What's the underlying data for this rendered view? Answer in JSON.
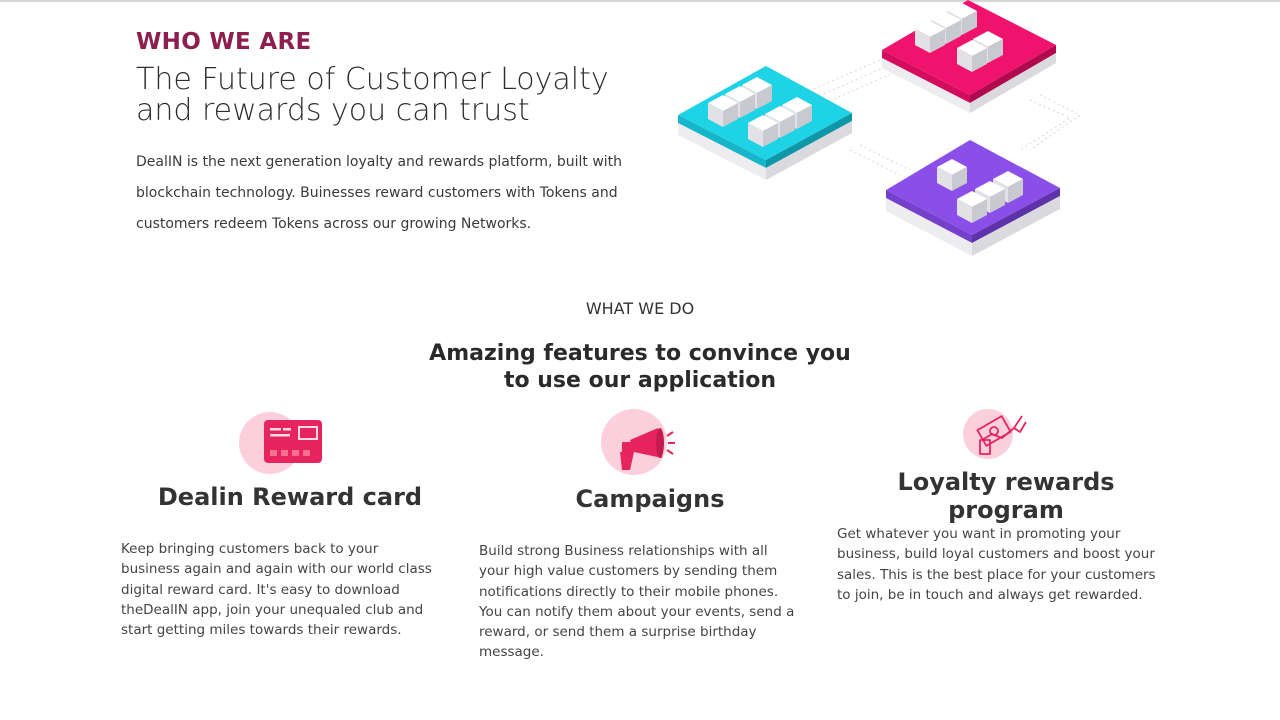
{
  "who": {
    "label": "WHO WE ARE",
    "title_line1": "The Future of Customer Loyalty",
    "title_line2": "and rewards you can trust",
    "description": "DealIN is the next generation loyalty and rewards platform, built with blockchain technology. Buinesses reward customers with Tokens and customers redeem Tokens across our growing Networks."
  },
  "what": {
    "label": "WHAT WE DO",
    "title_line1": "Amazing features to convince you",
    "title_line2": "to use our application"
  },
  "features": [
    {
      "title": "Dealin Reward card",
      "icon": "reward-card-icon",
      "description": "Keep bringing customers back to your business again and again with our world class digital reward card. It's easy to download theDealIN app, join your unequaled club and start getting miles towards their rewards."
    },
    {
      "title": "Campaigns",
      "icon": "megaphone-icon",
      "description": "Build strong Business relationships with all your high value customers by sending them notifications directly to their mobile phones. You can notify them about your events, send a reward, or send them a surprise birthday message."
    },
    {
      "title": "Loyalty rewards program",
      "icon": "cash-hand-icon",
      "description": "Get whatever you want in promoting your business, build loyal customers and boost your sales. This is the best place for your customers to join, be in touch and always get rewarded."
    }
  ],
  "colors": {
    "accent_maroon": "#8c1f4e",
    "icon_pink": "#e6245e",
    "icon_circle": "#fbd0dc",
    "tile_pink": "#f0136e",
    "tile_cyan": "#1fd3e6",
    "tile_purple": "#8a4fe8"
  }
}
